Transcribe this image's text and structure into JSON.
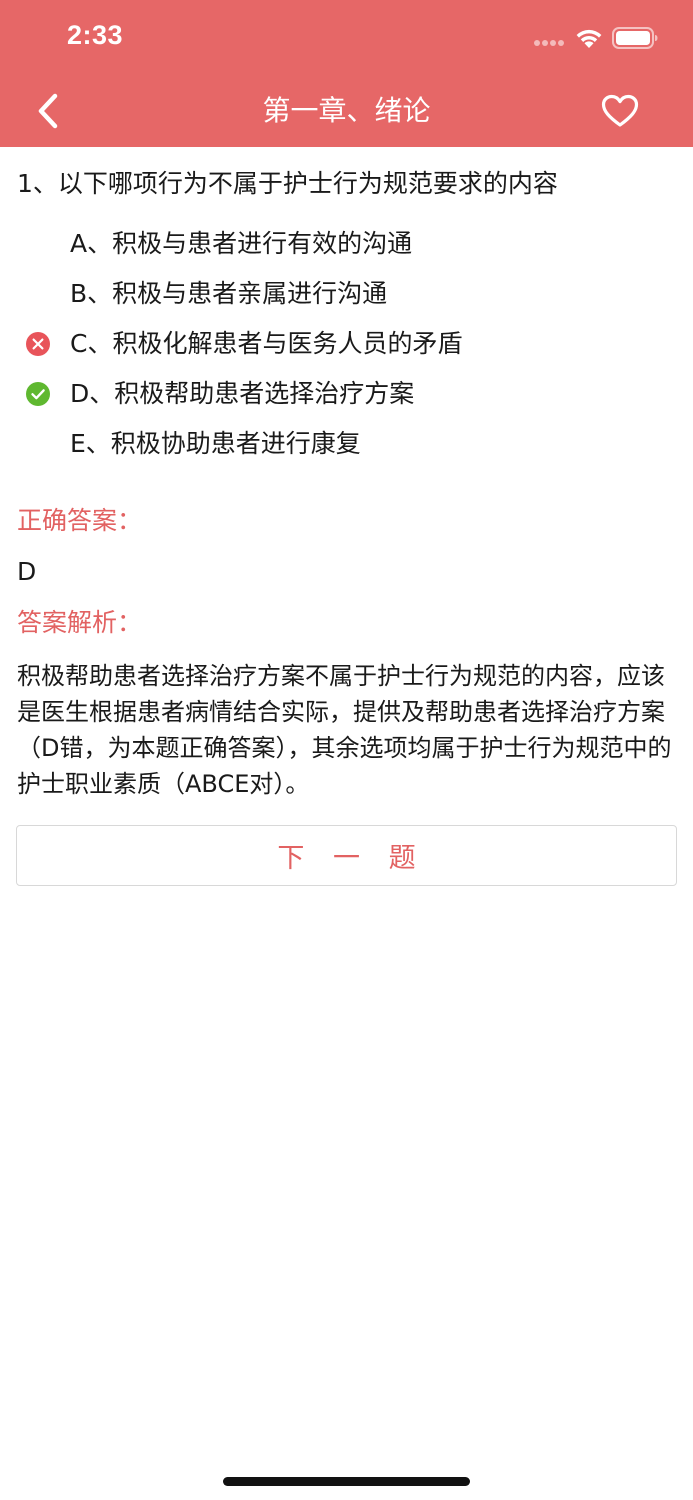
{
  "status_bar": {
    "time": "2:33"
  },
  "nav": {
    "title": "第一章、绪论",
    "back_icon": "chevron-left-icon",
    "favorite_icon": "heart-outline-icon"
  },
  "question": {
    "text": "1、以下哪项行为不属于护士行为规范要求的内容",
    "options": [
      {
        "text": "A、积极与患者进行有效的沟通",
        "mark": ""
      },
      {
        "text": "B、积极与患者亲属进行沟通",
        "mark": ""
      },
      {
        "text": "C、积极化解患者与医务人员的矛盾",
        "mark": "wrong"
      },
      {
        "text": "D、积极帮助患者选择治疗方案",
        "mark": "correct"
      },
      {
        "text": "E、积极协助患者进行康复",
        "mark": ""
      }
    ]
  },
  "answer": {
    "label": "正确答案：",
    "value": "D"
  },
  "analysis": {
    "label": "答案解析：",
    "text": "积极帮助患者选择治疗方案不属于护士行为规范的内容，应该是医生根据患者病情结合实际，提供及帮助患者选择治疗方案（D错，为本题正确答案），其余选项均属于护士行为规范中的护士职业素质（ABCE对）。"
  },
  "next_button": {
    "label": "下 一 题"
  },
  "colors": {
    "brand": "#e66767",
    "accent_text": "#e26262",
    "wrong": "#e8545a",
    "correct": "#5fb830"
  }
}
